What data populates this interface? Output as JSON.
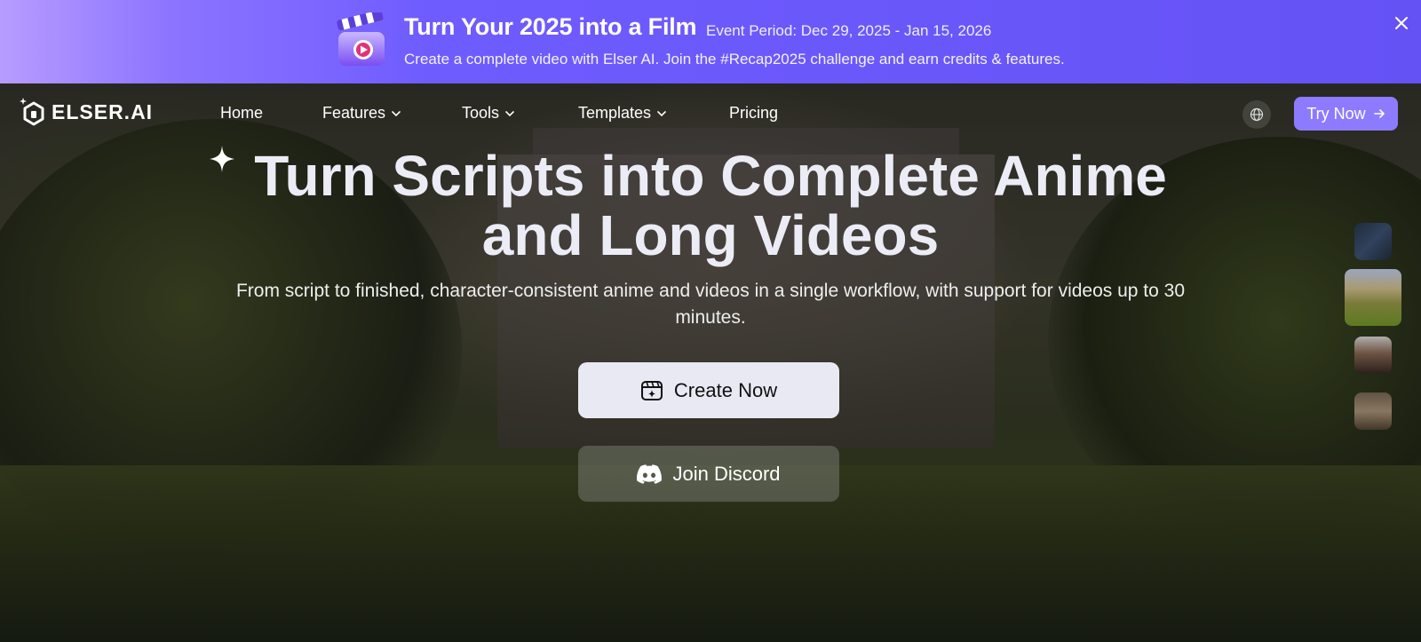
{
  "banner": {
    "title": "Turn Your 2025 into a Film",
    "period": "Event Period: Dec 29, 2025 - Jan 15, 2026",
    "subtitle": "Create a complete video with Elser AI. Join the #Recap2025 challenge and earn credits & features.",
    "icon": "clapperboard-play-icon",
    "close_icon": "close-icon",
    "colors": {
      "from": "#b79cff",
      "to": "#6552f5"
    }
  },
  "nav": {
    "logo_text": "ELSER.AI",
    "items": [
      {
        "label": "Home",
        "has_dropdown": false
      },
      {
        "label": "Features",
        "has_dropdown": true
      },
      {
        "label": "Tools",
        "has_dropdown": true
      },
      {
        "label": "Templates",
        "has_dropdown": true
      },
      {
        "label": "Pricing",
        "has_dropdown": false
      }
    ],
    "language_icon": "globe-icon",
    "cta_label": "Try Now",
    "cta_icon": "arrow-right-icon",
    "accent": "#8c7bff"
  },
  "hero": {
    "headline": "Turn Scripts into Complete Anime and Long Videos",
    "subtext": "From script to finished, character-consistent anime and videos in a single workflow, with support for videos up to 30 minutes.",
    "primary_button": "Create Now",
    "secondary_button": "Join Discord",
    "primary_icon": "calendar-sparkle-icon",
    "secondary_icon": "discord-icon"
  },
  "thumbnails": [
    {
      "name": "night-scene-thumbnail"
    },
    {
      "name": "manor-house-thumbnail",
      "selected": true
    },
    {
      "name": "character-portrait-thumbnail"
    },
    {
      "name": "interior-scene-thumbnail"
    }
  ]
}
